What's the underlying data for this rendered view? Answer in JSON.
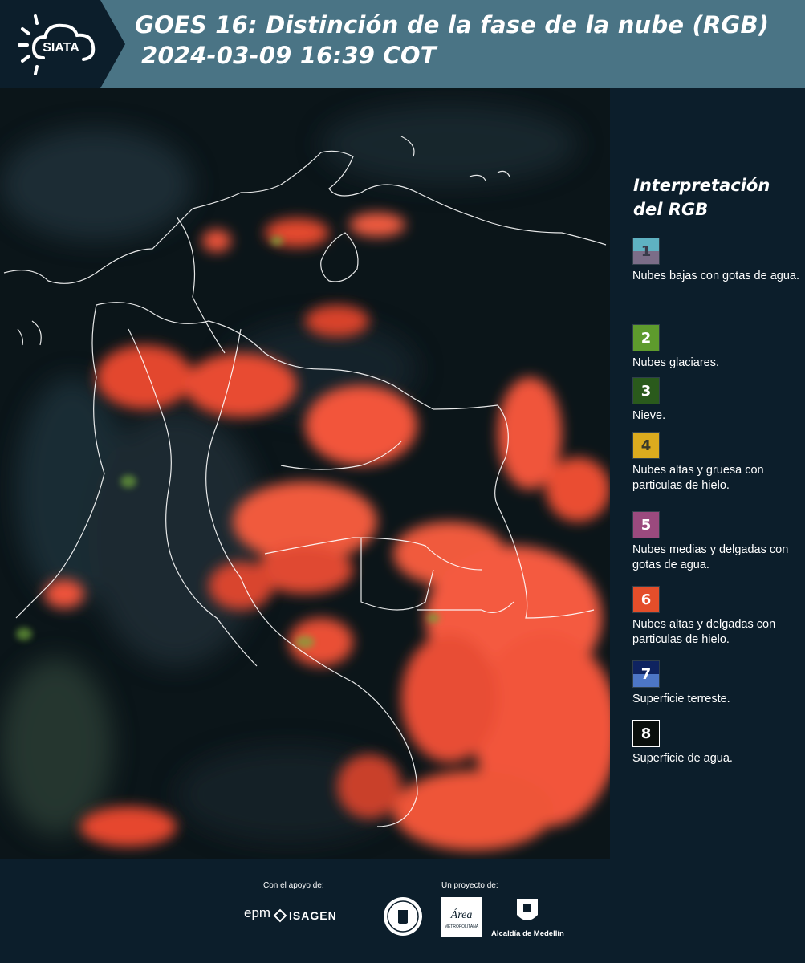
{
  "header": {
    "logo_text": "SIATA",
    "title_line1": "GOES 16: Distinción de la fase de la nube (RGB)",
    "title_line2": "2024-03-09 16:39 COT"
  },
  "map": {
    "icon": "satellite-rgb-map",
    "colors": {
      "background": "#0a1317",
      "cloud_ice": "#ff5a3d",
      "borders": "#ffffff"
    }
  },
  "legend": {
    "title_line1": "Interpretación",
    "title_line2": "del RGB",
    "items": [
      {
        "number": "1",
        "label": "Nubes bajas con gotas de agua.",
        "color_top": "#5fb2c2",
        "color_bottom": "#7b6d88",
        "text_color": "#3a3a4a"
      },
      {
        "number": "2",
        "label": "Nubes glaciares.",
        "color_top": "#5e9b2d",
        "color_bottom": "#5e9b2d",
        "text_color": "#ffffff"
      },
      {
        "number": "3",
        "label": "Nieve.",
        "color_top": "#2a5a1c",
        "color_bottom": "#2a5a1c",
        "text_color": "#ffffff"
      },
      {
        "number": "4",
        "label": "Nubes altas y gruesa con particulas de hielo.",
        "color_top": "#dcab1e",
        "color_bottom": "#dcab1e",
        "text_color": "#3a3a2a"
      },
      {
        "number": "5",
        "label": "Nubes medias y delgadas con gotas de agua.",
        "color_top": "#9b4a7e",
        "color_bottom": "#9b4a7e",
        "text_color": "#ffffff"
      },
      {
        "number": "6",
        "label": "Nubes altas y delgadas con particulas de hielo.",
        "color_top": "#e44e2a",
        "color_bottom": "#e44e2a",
        "text_color": "#ffffff"
      },
      {
        "number": "7",
        "label": "Superficie terreste.",
        "color_top": "#0f2360",
        "color_bottom": "#4d76c6",
        "text_color": "#ffffff"
      },
      {
        "number": "8",
        "label": "Superficie de agua.",
        "color_top": "#0a0f0c",
        "color_bottom": "#0a0f0c",
        "text_color": "#ffffff"
      }
    ]
  },
  "footer": {
    "support_label": "Con el apoyo de:",
    "project_label": "Un proyecto de:",
    "sponsor1": "epm",
    "sponsor2": "ISAGEN",
    "partner1": "Área Metropolitana Valle de Aburrá",
    "partner2": "Alcaldía de Medellín",
    "partner1_name": "Área",
    "partner1_sub": "METROPOLITANA"
  }
}
